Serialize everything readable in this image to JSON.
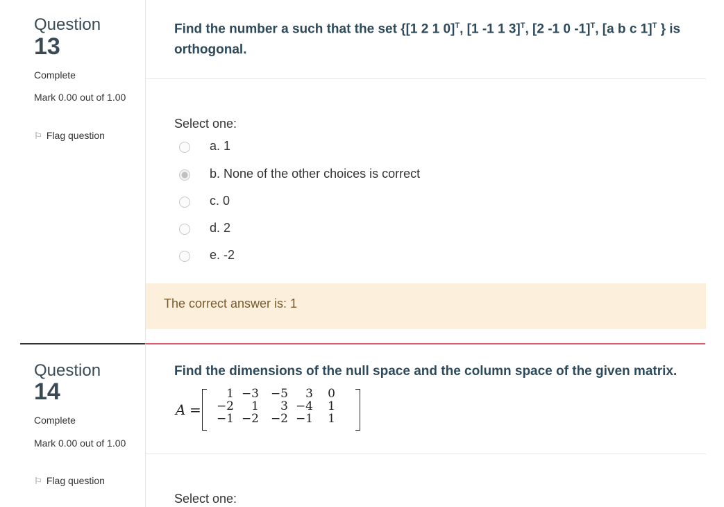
{
  "questions": [
    {
      "word": "Question",
      "number": "13",
      "state": "Complete",
      "grade": "Mark 0.00 out of 1.00",
      "flag_label": "Flag question",
      "text_part1": "Find the number a such that the set {[1 2 1 0]",
      "sup": "T",
      "text_part2": ", [1 -1 1 3]",
      "text_part3": ", [2 -1 0 -1]",
      "text_part4": ", [a b c 1]",
      "text_part5": " } is orthogonal.",
      "prompt": "Select one:",
      "options": [
        {
          "label": "a. 1",
          "checked": false
        },
        {
          "label": "b. None of the other choices is correct",
          "checked": true
        },
        {
          "label": "c. 0",
          "checked": false
        },
        {
          "label": "d. 2",
          "checked": false
        },
        {
          "label": "e. -2",
          "checked": false
        }
      ],
      "feedback": "The correct answer is: 1"
    },
    {
      "word": "Question",
      "number": "14",
      "state": "Complete",
      "grade": "Mark 0.00 out of 1.00",
      "flag_label": "Flag question",
      "text": "Find the dimensions of the null space and the column space of the given matrix.",
      "matrix_name": "A",
      "matrix_eq": "=",
      "matrix": [
        [
          "1",
          "−3",
          "−5",
          "3",
          "0"
        ],
        [
          "−2",
          "1",
          "3",
          "−4",
          "1"
        ],
        [
          "−1",
          "−2",
          "−2",
          "−1",
          "1"
        ]
      ],
      "prompt": "Select one:"
    }
  ]
}
